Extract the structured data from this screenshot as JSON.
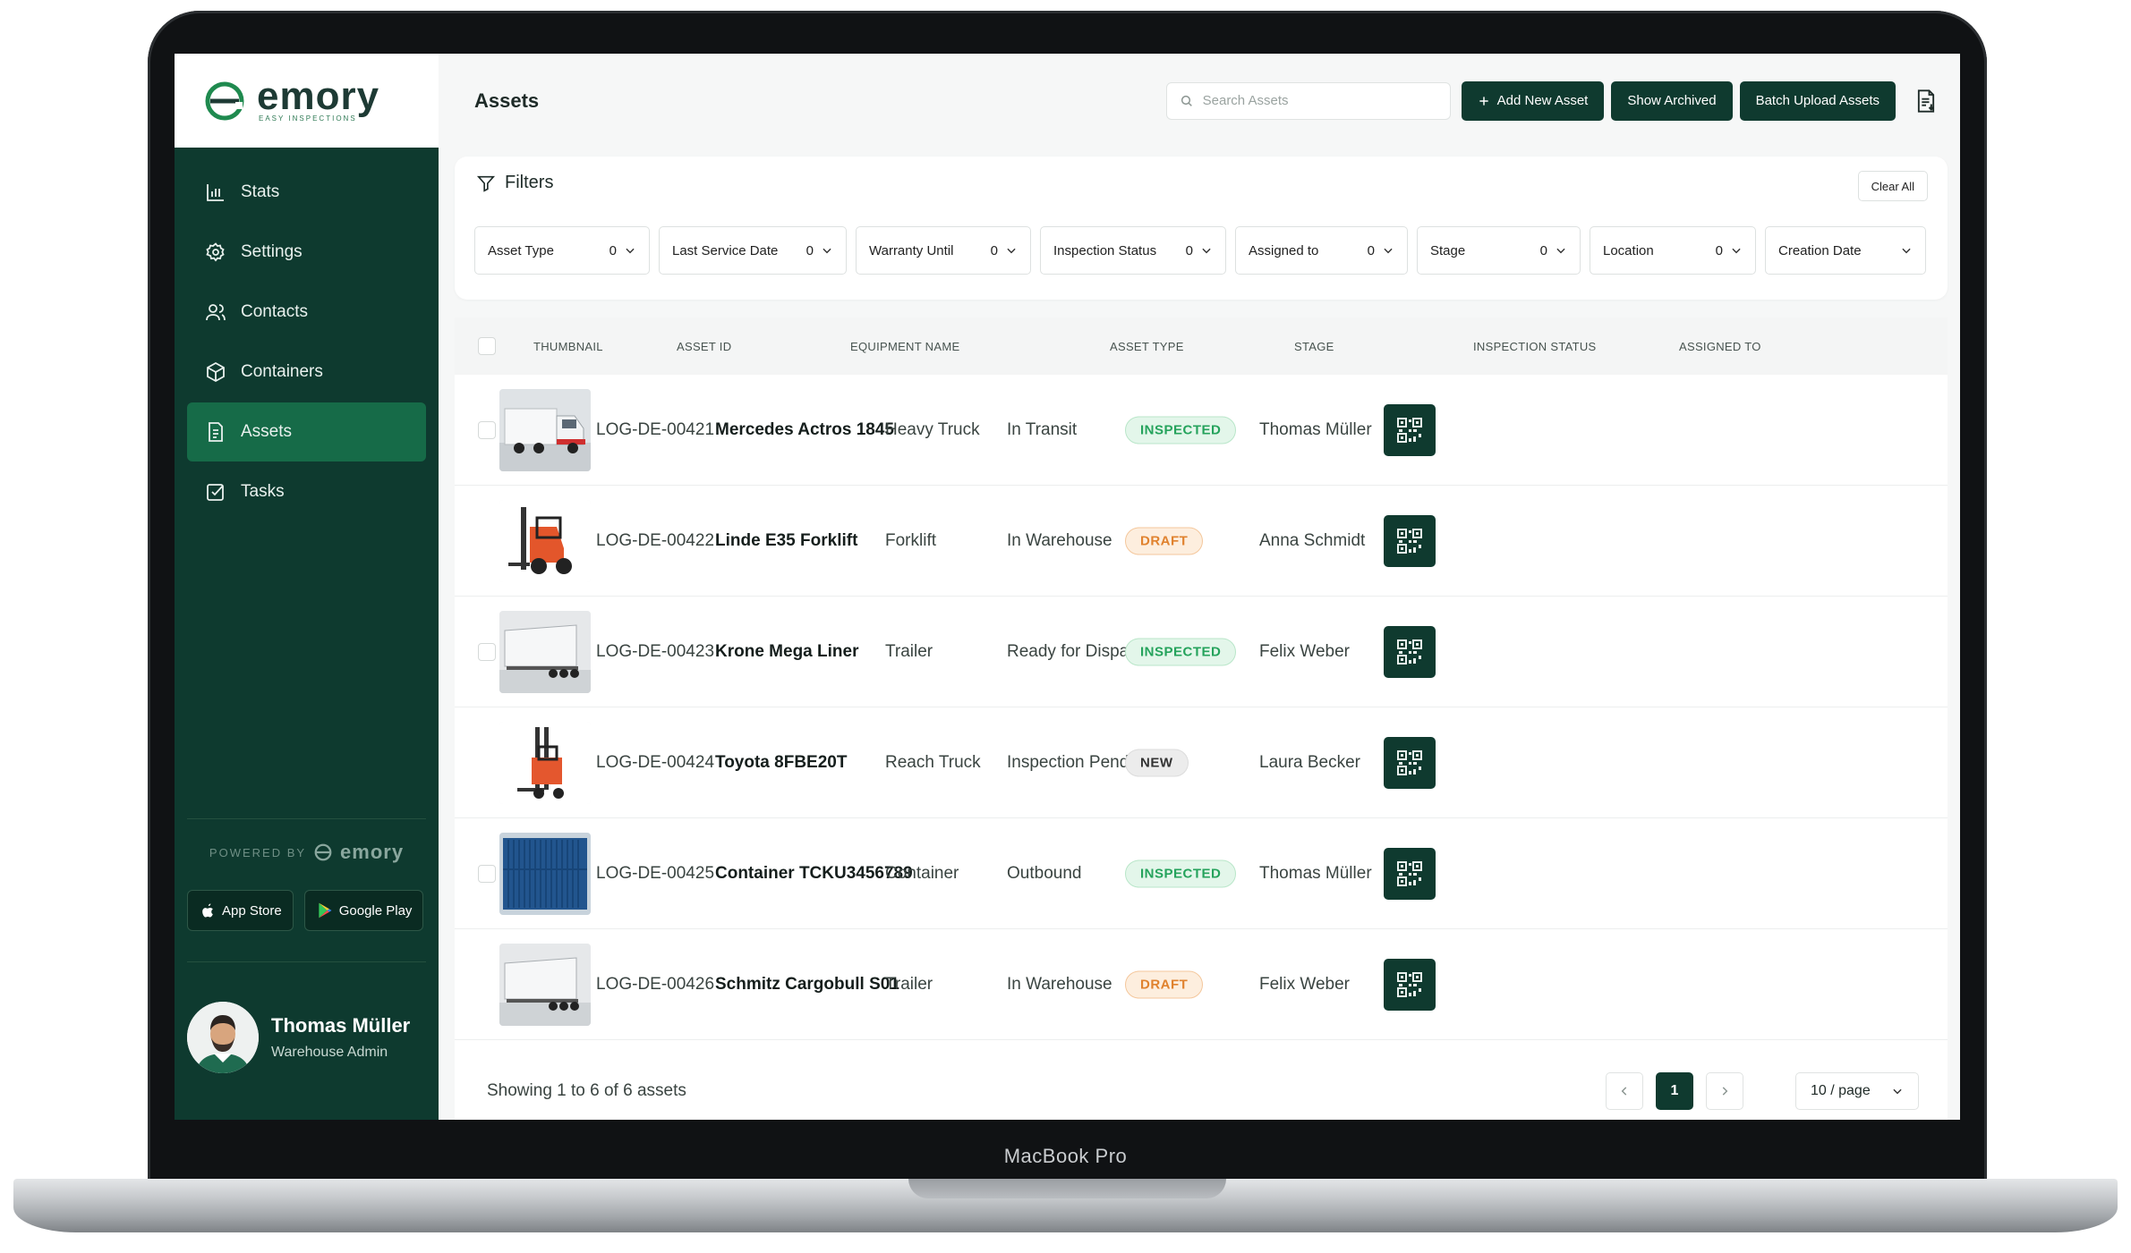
{
  "colors": {
    "sidebar_bg": "#0e3a2f",
    "sidebar_active": "#166b48",
    "button_dark": "#0f3a2f",
    "badge_inspected_bg": "#e3f6ea",
    "badge_inspected_fg": "#25a35c",
    "badge_draft_bg": "#fdeede",
    "badge_draft_fg": "#e0822e",
    "badge_new_bg": "#ececec",
    "badge_new_fg": "#333333"
  },
  "brand": {
    "name": "emory",
    "tagline": "EASY INSPECTIONS"
  },
  "sidebar": {
    "items": [
      {
        "label": "Stats",
        "icon": "bar-chart-icon"
      },
      {
        "label": "Settings",
        "icon": "gear-icon"
      },
      {
        "label": "Contacts",
        "icon": "users-icon"
      },
      {
        "label": "Containers",
        "icon": "box-icon"
      },
      {
        "label": "Assets",
        "icon": "document-icon",
        "active": true
      },
      {
        "label": "Tasks",
        "icon": "checkbox-icon"
      }
    ],
    "powered_by": "POWERED BY",
    "powered_brand": "emory",
    "app_store": "App Store",
    "google_play": "Google Play",
    "user": {
      "name": "Thomas Müller",
      "role": "Warehouse Admin"
    }
  },
  "header": {
    "title": "Assets",
    "search_placeholder": "Search Assets",
    "add_button": "Add New Asset",
    "archived_button": "Show Archived",
    "batch_button": "Batch Upload Assets"
  },
  "filters": {
    "title": "Filters",
    "clear_all": "Clear All",
    "items": [
      {
        "label": "Asset Type",
        "count": "0"
      },
      {
        "label": "Last Service Date",
        "count": "0"
      },
      {
        "label": "Warranty Until",
        "count": "0"
      },
      {
        "label": "Inspection Status",
        "count": "0"
      },
      {
        "label": "Assigned to",
        "count": "0"
      },
      {
        "label": "Stage",
        "count": "0"
      },
      {
        "label": "Location",
        "count": "0"
      },
      {
        "label": "Creation Date",
        "count": ""
      }
    ]
  },
  "table": {
    "columns": [
      "THUMBNAIL",
      "ASSET ID",
      "EQUIPMENT NAME",
      "ASSET TYPE",
      "STAGE",
      "INSPECTION STATUS",
      "ASSIGNED TO"
    ],
    "rows": [
      {
        "asset_id": "LOG-DE-00421",
        "name": "Mercedes Actros 1845",
        "type": "Heavy Truck",
        "stage": "In Transit",
        "status": "INSPECTED",
        "assigned": "Thomas Müller",
        "thumb": "truck"
      },
      {
        "asset_id": "LOG-DE-00422",
        "name": "Linde E35 Forklift",
        "type": "Forklift",
        "stage": "In Warehouse",
        "status": "DRAFT",
        "assigned": "Anna Schmidt",
        "thumb": "forklift"
      },
      {
        "asset_id": "LOG-DE-00423",
        "name": "Krone Mega Liner",
        "type": "Trailer",
        "stage": "Ready for Dispatch",
        "status": "INSPECTED",
        "assigned": "Felix Weber",
        "thumb": "trailer"
      },
      {
        "asset_id": "LOG-DE-00424",
        "name": "Toyota 8FBE20T",
        "type": "Reach Truck",
        "stage": "Inspection Pending",
        "status": "NEW",
        "assigned": "Laura Becker",
        "thumb": "reach"
      },
      {
        "asset_id": "LOG-DE-00425",
        "name": "Container TCKU3456789",
        "type": "Container",
        "stage": "Outbound",
        "status": "INSPECTED",
        "assigned": "Thomas Müller",
        "thumb": "container"
      },
      {
        "asset_id": "LOG-DE-00426",
        "name": "Schmitz Cargobull S01",
        "type": "Trailer",
        "stage": "In Warehouse",
        "status": "DRAFT",
        "assigned": "Felix Weber",
        "thumb": "trailer"
      }
    ]
  },
  "footer": {
    "showing": "Showing 1 to 6 of 6 assets",
    "current_page": "1",
    "per_page": "10 / page"
  },
  "device": {
    "label": "MacBook Pro"
  }
}
